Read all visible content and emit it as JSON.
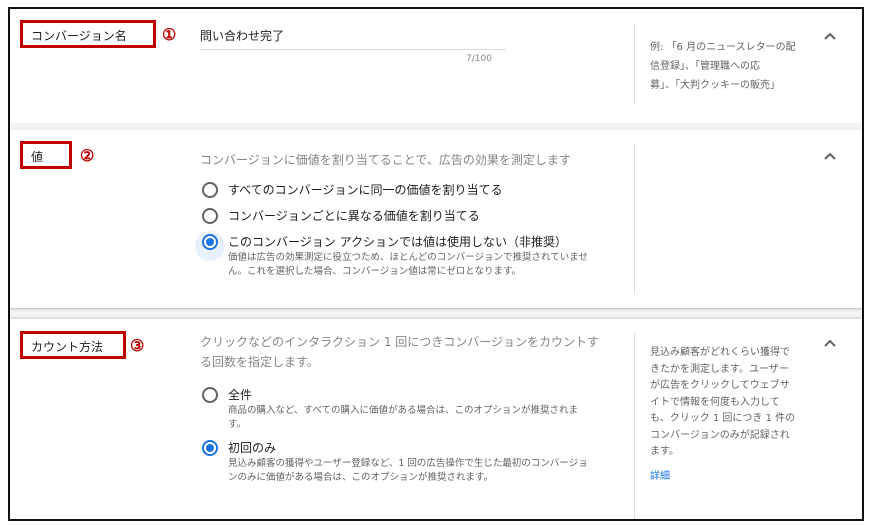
{
  "sections": {
    "name": {
      "label": "コンバージョン名",
      "marker": "①",
      "value": "問い合わせ完了",
      "counter": "7/100",
      "hint_lines": [
        "例: 「6 月のニュースレターの配",
        "信登録」、「管理職への応",
        "募」、「大判クッキーの販売」"
      ]
    },
    "value": {
      "label": "値",
      "marker": "②",
      "description": "コンバージョンに価値を割り当てることで、広告の効果を測定します",
      "options": [
        {
          "label": "すべてのコンバージョンに同一の価値を割り当てる",
          "selected": false
        },
        {
          "label": "コンバージョンごとに異なる価値を割り当てる",
          "selected": false
        },
        {
          "label": "このコンバージョン アクションでは値は使用しない（非推奨）",
          "selected": true,
          "sub_lines": [
            "価値は広告の効果測定に役立つため、ほとんどのコンバージョンで推奨されていませ",
            "ん。これを選択した場合、コンバージョン値は常にゼロとなります。"
          ]
        }
      ]
    },
    "count": {
      "label": "カウント方法",
      "marker": "③",
      "description_lines": [
        "クリックなどのインタラクション 1 回につきコンバージョンをカウントす",
        "る回数を指定します。"
      ],
      "options": [
        {
          "label": "全件",
          "selected": false,
          "sub_lines": [
            "商品の購入など、すべての購入に価値がある場合は、このオプションが推奨されま",
            "す。"
          ]
        },
        {
          "label": "初回のみ",
          "selected": true,
          "sub_lines": [
            "見込み顧客の獲得やユーザー登録など、1 回の広告操作で生じた最初のコンバージョ",
            "ンのみに価値がある場合は、このオプションが推奨されます。"
          ]
        }
      ],
      "help_lines": [
        "見込み顧客がどれくらい獲得で",
        "きたかを測定します。ユーザー",
        "が広告をクリックしてウェブサ",
        "イトで情報を何度も入力して",
        "も、クリック 1 回につき 1 件の",
        "コンバージョンのみが記録され",
        "ます。"
      ],
      "help_link": "詳細"
    }
  },
  "icons": {
    "collapse": "chevron-up-icon"
  },
  "colors": {
    "accent": "#1a73e8",
    "annotation": "#c00000"
  }
}
